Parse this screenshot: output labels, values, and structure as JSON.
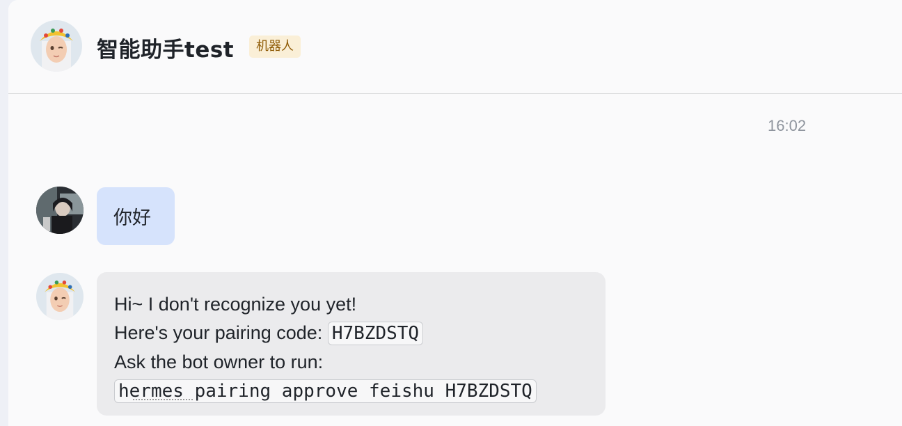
{
  "header": {
    "title": "智能助手test",
    "tag": "机器人"
  },
  "conversation": {
    "timestamp": "16:02",
    "user_message": "你好",
    "bot_message": {
      "line1": "Hi~ I don't recognize you yet!",
      "line2_prefix": "Here's your pairing code:",
      "pairing_code": "H7BZDSTQ",
      "line3": "Ask the bot owner to run:",
      "command": "hermes pairing approve feishu H7BZDSTQ"
    }
  },
  "icons": {
    "bot_avatar": "anime-girl-yellow-hat-avatar",
    "user_avatar": "dark-photo-avatar"
  },
  "colors": {
    "user_bubble": "#d6e3fc",
    "bot_bubble": "#ebebed",
    "tag_bg": "#faefd7",
    "tag_text": "#8f5b06"
  }
}
